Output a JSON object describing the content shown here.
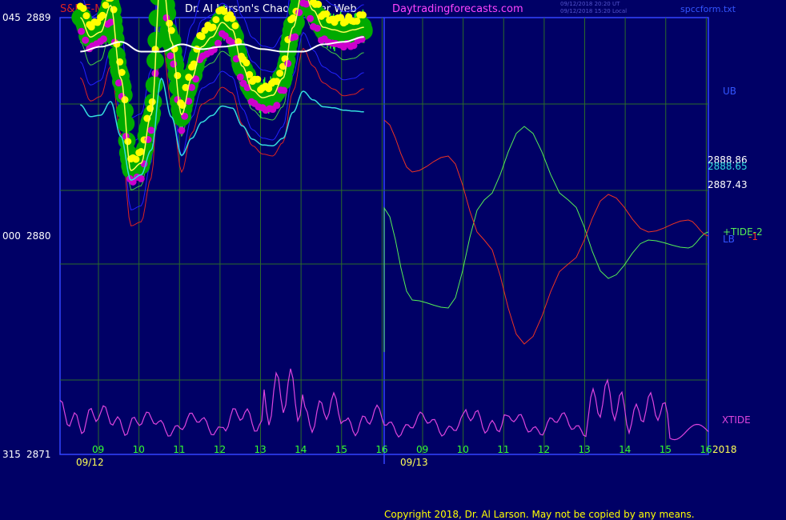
{
  "header": {
    "symbol": "S&P E-Mini",
    "title": "Dr. Al Larson's Chaos Trader Web",
    "site": "Daytradingforecasts.com",
    "timestamp_ut": "09/12/2018 20:20 UT",
    "timestamp_local": "09/12/2018 15:20 Local",
    "filename": "spccform.txt"
  },
  "footer": {
    "copyright": "Copyright 2018, Dr. Al Larson. May not be copied by any means."
  },
  "colors": {
    "background": "#000066",
    "grid": "#2a6a2a",
    "plot_border": "#3344ff",
    "price_line": "#33ff33",
    "price_hlc_bars": "#22ff22",
    "ma_short": "#ffff55",
    "ma_mid": "#33dddd",
    "ma_long": "#ffffff",
    "bands": "#2222ff",
    "inner_band": "#44cc44",
    "lower_band": "#dd2222",
    "tide_green": "#55ee55",
    "tide_red": "#ee3322",
    "xtide": "#dd44dd",
    "dot_yellow": "#ffff00",
    "dot_magenta": "#cc00cc",
    "dot_green": "#00aa00"
  },
  "chart_data": {
    "type": "line",
    "title": "S&P E-Mini",
    "y_axis_left": {
      "ticks": [
        {
          "value": 2889,
          "label": "2889",
          "prefix": "045"
        },
        {
          "value": 2880,
          "label": "2880",
          "prefix": "000"
        },
        {
          "value": 2871,
          "label": "2871",
          "prefix": "315"
        }
      ],
      "ylim": [
        2871,
        2889
      ]
    },
    "x_axis": {
      "hour_ticks": [
        "09",
        "10",
        "11",
        "12",
        "13",
        "14",
        "15",
        "16",
        "09",
        "10",
        "11",
        "12",
        "13",
        "14",
        "15",
        "16"
      ],
      "date_labels": [
        "09/12",
        "09/13"
      ],
      "year_label": "2018"
    },
    "right_labels": {
      "ub": "UB",
      "price_high": "2888.86",
      "price_mid": "2888.65",
      "price_last": "2887.43",
      "tide2": "+TIDE-2",
      "lb": "LB",
      "tide1": "-1",
      "xtide": "XTIDE"
    },
    "series": [
      {
        "name": "Price",
        "x": [
          9.0,
          9.25,
          9.5,
          9.75,
          10.0,
          10.25,
          10.5,
          10.75,
          11.0,
          11.25,
          11.5,
          11.75,
          12.0,
          12.25,
          12.5,
          12.75,
          13.0,
          13.25,
          13.5,
          13.75,
          14.0,
          14.25,
          14.5,
          14.75,
          15.0,
          15.25,
          15.5,
          15.75,
          16.0
        ],
        "values": [
          2889.0,
          2888.2,
          2888.4,
          2889.5,
          2886.5,
          2882.7,
          2883.0,
          2885.0,
          2891.0,
          2888.0,
          2885.0,
          2886.5,
          2887.8,
          2888.2,
          2888.8,
          2888.5,
          2887.0,
          2886.0,
          2885.7,
          2885.8,
          2886.5,
          2888.6,
          2890.2,
          2889.3,
          2888.6,
          2888.5,
          2888.4,
          2888.5,
          2888.6
        ]
      },
      {
        "name": "Moving average (white)",
        "x": [
          9.0,
          9.5,
          10.0,
          10.5,
          11.0,
          11.5,
          12.0,
          12.5,
          13.0,
          13.5,
          14.0,
          14.5,
          15.0,
          15.5,
          16.0
        ],
        "values": [
          2887.6,
          2887.8,
          2888.0,
          2887.6,
          2887.6,
          2887.9,
          2887.7,
          2887.8,
          2887.9,
          2887.7,
          2887.6,
          2887.6,
          2887.9,
          2888.0,
          2888.2
        ]
      },
      {
        "name": "XTIDE",
        "x": [
          9,
          10,
          11,
          12,
          13,
          14,
          15,
          16,
          17,
          18,
          19,
          20,
          21,
          22,
          23,
          24
        ],
        "values": [
          0.4,
          0.3,
          0.2,
          0.2,
          0.3,
          0.9,
          0.5,
          0.3,
          0.2,
          0.2,
          0.3,
          0.2,
          0.2,
          0.7,
          0.5,
          0.3
        ]
      }
    ]
  }
}
